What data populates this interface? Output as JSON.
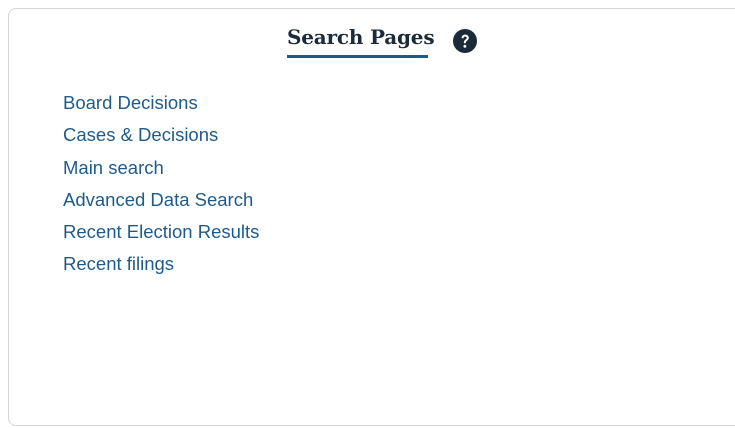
{
  "panel": {
    "title": "Search Pages",
    "help_icon": "question-circle-icon",
    "links": [
      {
        "label": "Board Decisions"
      },
      {
        "label": "Cases & Decisions"
      },
      {
        "label": "Main search"
      },
      {
        "label": "Advanced Data Search"
      },
      {
        "label": "Recent Election Results"
      },
      {
        "label": "Recent filings"
      }
    ]
  },
  "colors": {
    "link": "#1f5b8a",
    "title": "#1b2b3a",
    "underline": "#1f5b8a",
    "border": "#d4d4d4"
  }
}
